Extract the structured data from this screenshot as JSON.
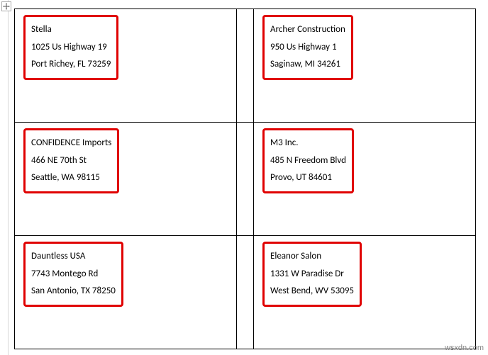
{
  "labels": [
    {
      "name": "Stella",
      "street": "1025 Us Highway 19",
      "citystate": "Port Richey, FL 73259"
    },
    {
      "name": "Archer Construction",
      "street": "950 Us Highway 1",
      "citystate": "Saginaw, MI 34261"
    },
    {
      "name": "CONFIDENCE Imports",
      "street": "466 NE 70th St",
      "citystate": "Seattle, WA 98115"
    },
    {
      "name": "M3 Inc.",
      "street": "485 N Freedom Blvd",
      "citystate": "Provo, UT 84601"
    },
    {
      "name": "Dauntless USA",
      "street": "7743 Montego Rd",
      "citystate": "San Antonio, TX 78250"
    },
    {
      "name": "Eleanor Salon",
      "street": "1331 W Paradise Dr",
      "citystate": "West Bend, WV 53095"
    }
  ],
  "watermark": "wsxdn.com"
}
